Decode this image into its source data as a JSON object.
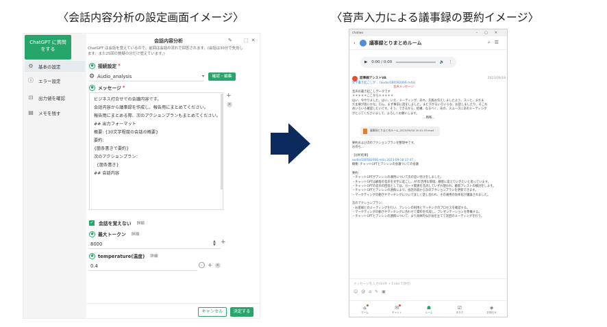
{
  "captions": {
    "left": "〈会話内容分析の設定画面イメージ〉",
    "right": "〈音声入力による議事録の要約イメージ〉"
  },
  "settings": {
    "sidebar": {
      "gpt_button": "ChatGPT に質問をする",
      "items": [
        {
          "label": "基本の設定",
          "icon": "gear-icon",
          "active": true
        },
        {
          "label": "エラー設定",
          "icon": "info-icon"
        },
        {
          "label": "出力値を確認",
          "icon": "output-icon"
        },
        {
          "label": "メモを残す",
          "icon": "memo-icon"
        }
      ]
    },
    "title": "会話内容分析",
    "note": "ChatGPT は会話を覚えているので、前回は会話の流れで回答されます。(会話は30分で失効します。また25回の質疑の分だけ覚えています。)",
    "connection": {
      "label": "接続設定",
      "value": "Audio_analysis",
      "confirm_button": "確認・編集"
    },
    "message": {
      "label": "メッセージ",
      "lines": [
        "ビジネス打合せでの会議内容です。",
        "会話内容から議事録を作成し、報告用にまとめてください。",
        "報告用にまとめる際、次のアクションプランもまとめてください。",
        "",
        "## 出力フォーマット",
        "概要: {30文字程度の会話の概要}",
        "要約:",
        "{箇条書きで要約}",
        "",
        "次のアクションプラン：",
        "  {箇条書き}",
        "## 会話内容"
      ]
    },
    "forget": {
      "label": "会話を覚えない",
      "detail": "詳細"
    },
    "max_tokens": {
      "label": "最大トークン",
      "detail": "詳細",
      "value": "8000"
    },
    "temperature": {
      "label": "temperature(温度)",
      "detail": "詳細",
      "value": "0.4"
    },
    "cancel_button": "キャンセル",
    "ok_button": "決定する"
  },
  "chat": {
    "window_title": "chatwo",
    "room_title": "議事録とりまとめルーム",
    "audio": {
      "time": "0:00 / 0:00"
    },
    "sender": "話事録アシストVA",
    "sender_time": "2023/09/18",
    "sender_sub": "文字書き起こしが… (audio/180582066.m4a)",
    "tag": "音声メッセージ",
    "transcript_title": "音声の書き起こしデータです",
    "stars": "＊＊＊＊＊ここから＊＊＊＊＊",
    "transcript": [
      "はい、今やりました。はい、いえ、ミーティング、あれ、先般お伝えしましたよう、スッと、まだま",
      "だ主要が高いかな。ロム、まず事前に話をしました。また下がるいろいろな、お話しましたり、そこれ",
      "めいろいろ確認したいです。そう、できるから、結構、なるべく、あの、スムーズにあのミーティング",
      "がとってくださいまして、よろしくお願いします。"
    ],
    "end_marker": "…略略…",
    "file_name": "議事録とりまとめルーム_2023/09/18 20:01:33.mp4",
    "summary_intro": [
      "要約および次のアクションプランを整理中です。",
      "お待ち…"
    ],
    "result_title": "【分析結果】",
    "result_file": "audio/180582066.m4a 2023-09-18 17:47",
    "overview": "概要: チャットGPTとアシレンの会議ついての会議",
    "summary_label": "要約:",
    "summary_items": [
      "・チャットGPTがアシレンの運用について次の追い付けをしました。",
      "・チャットGPTは顧客の音声を文字に起こし、ATの活用な環境、顧客に変えていきたいと思っています。",
      "・チャットGPTの音声の回答としては、カード関連を音声していずれ使われ、顧客アシストの検討をします。",
      "・チャットGPTとアシレンの連携により、会話内容から次のアクションプランを更新できます。",
      "・マーケティングの動きやマッチングについて詳しく話し合われ、その運用の効率化が議論されました。"
    ],
    "next_label": "次のアクションプラン：",
    "next_items": [
      "・お客様とのミーティングを行い、アシレンの利用とマッチングのプロセスを確認する。",
      "・マーケティングの動きやマッチングに合わせて資料を作成し、プレゼンテーションを準備する。",
      "・チャットGPTとアシレンの連携について、より具体的な計画を立てて次回のミーティングを行う。"
    ],
    "input_placeholder": "メッセージを入力(Shift + Enterで改行)",
    "tabs": [
      "ホーム",
      "チャット",
      "ルーム",
      "タスク",
      "お知らせ"
    ]
  }
}
